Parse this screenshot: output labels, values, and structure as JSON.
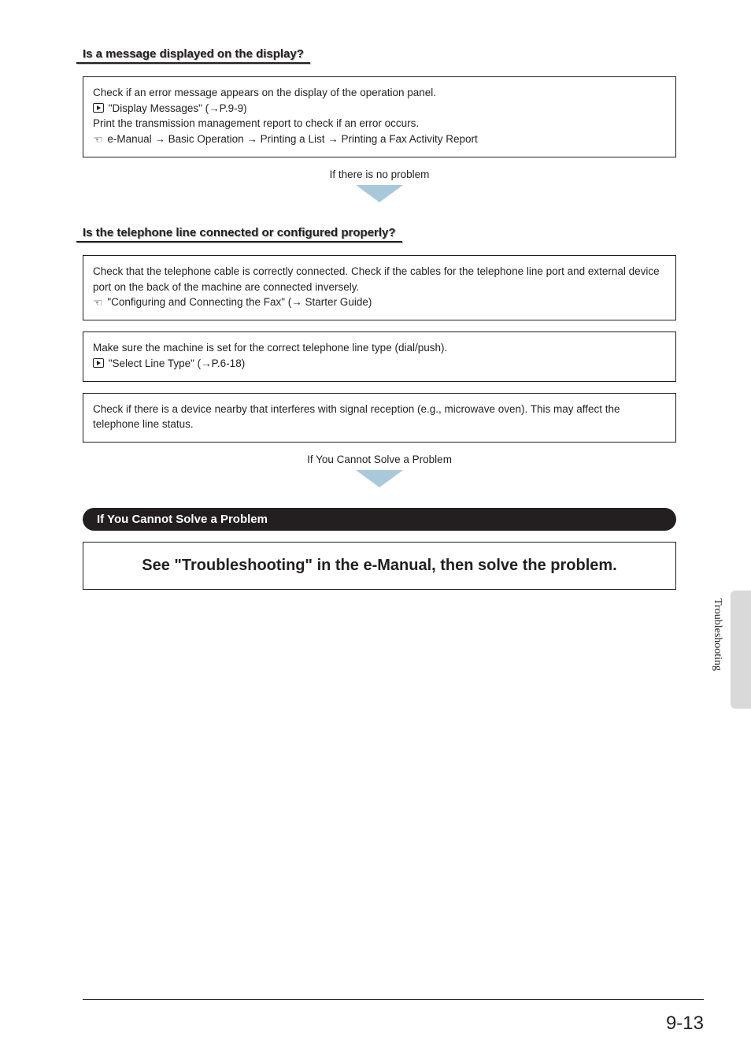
{
  "section1": {
    "heading": "Is a message displayed on the display?",
    "box1": {
      "line1": "Check if an error message appears on the display of the operation panel.",
      "ref1": "\"Display Messages\" (→P.9-9)",
      "line2": "Print the transmission management report to check if an error occurs.",
      "ref2": "e-Manual → Basic Operation → Printing a List → Printing a Fax Activity Report"
    },
    "flow": "If there is no problem"
  },
  "section2": {
    "heading": "Is the telephone line connected or configured properly?",
    "box1": {
      "line1": "Check that the telephone cable is correctly connected. Check if the cables for the telephone line port and external device port on the back of the machine are connected inversely.",
      "ref1": "\"Configuring and Connecting the Fax\" (→ Starter Guide)"
    },
    "box2": {
      "line1": "Make sure the machine is set for the correct telephone line type (dial/push).",
      "ref1": "\"Select Line Type\" (→P.6-18)"
    },
    "box3": {
      "line1": "Check if there is a device nearby that interferes with signal reception (e.g., microwave oven). This may affect the telephone line status."
    },
    "flow": "If You Cannot Solve a Problem"
  },
  "section3": {
    "pill": "If You Cannot Solve a Problem",
    "big": "See \"Troubleshooting\" in the e-Manual, then solve the problem."
  },
  "sideTab": "Troubleshooting",
  "pageNum": "9-13"
}
